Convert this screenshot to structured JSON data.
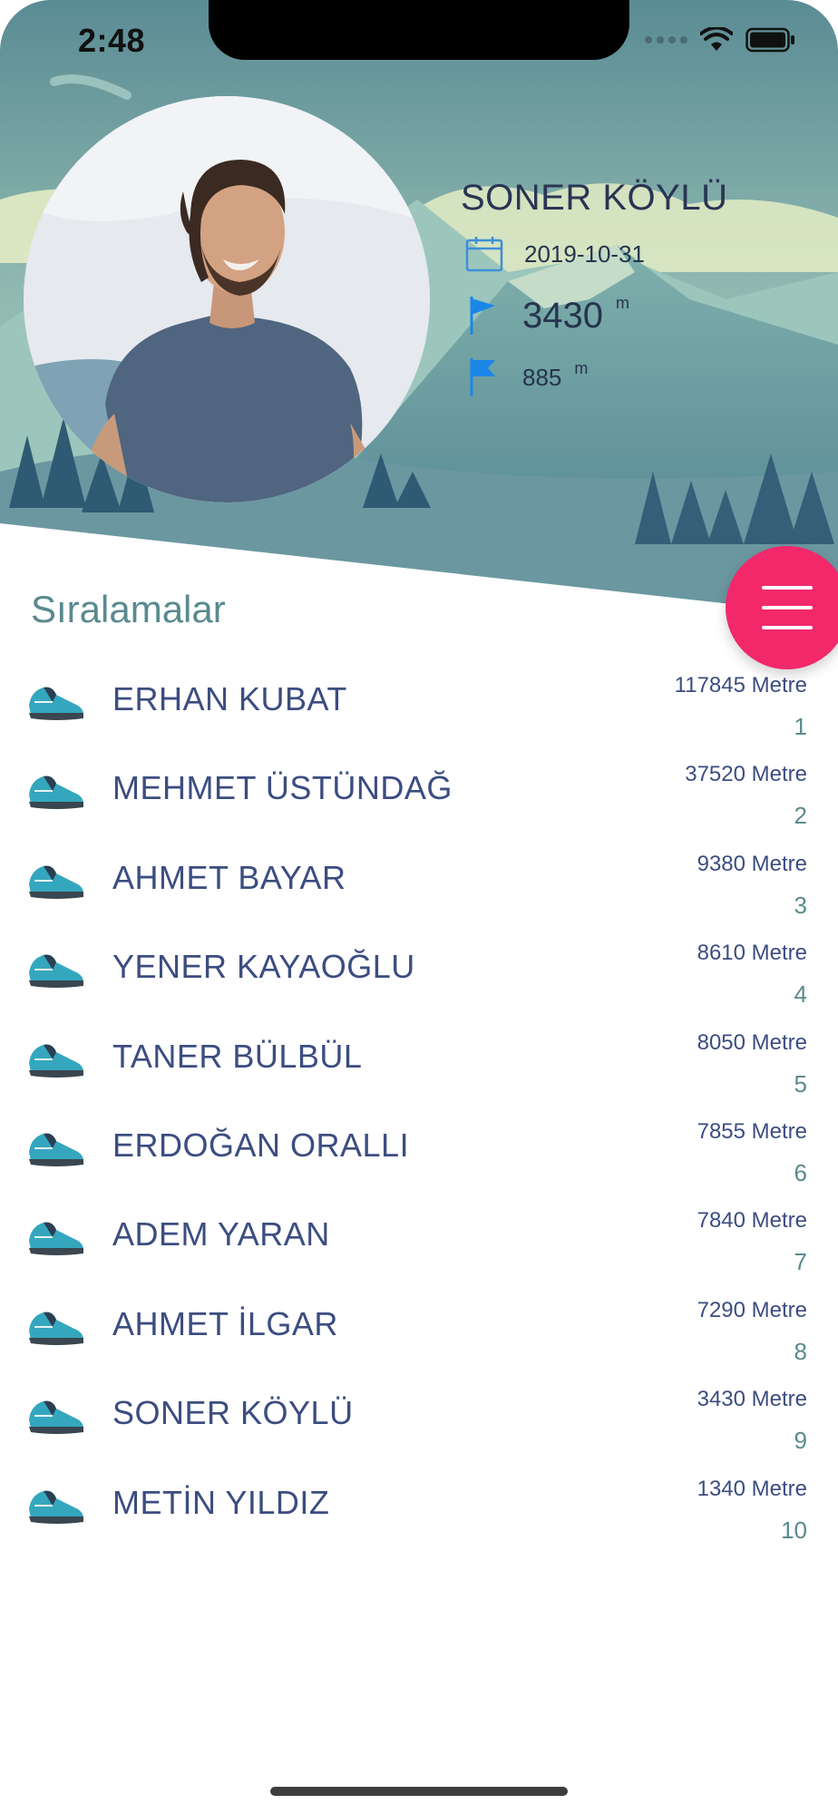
{
  "status_bar": {
    "time": "2:48"
  },
  "profile": {
    "name": "SONER KÖYLÜ",
    "date": "2019-10-31",
    "distance": "3430",
    "distance_unit": "m",
    "climb": "885",
    "climb_unit": "m"
  },
  "section": {
    "title": "Sıralamalar"
  },
  "ranking": [
    {
      "name": "ERHAN KUBAT",
      "distance": "117845 Metre",
      "position": "1"
    },
    {
      "name": "MEHMET ÜSTÜNDAĞ",
      "distance": "37520 Metre",
      "position": "2"
    },
    {
      "name": "AHMET BAYAR",
      "distance": "9380 Metre",
      "position": "3"
    },
    {
      "name": "YENER KAYAOĞLU",
      "distance": "8610 Metre",
      "position": "4"
    },
    {
      "name": "TANER BÜLBÜL",
      "distance": "8050 Metre",
      "position": "5"
    },
    {
      "name": "ERDOĞAN ORALLI",
      "distance": "7855 Metre",
      "position": "6"
    },
    {
      "name": "ADEM YARAN",
      "distance": "7840 Metre",
      "position": "7"
    },
    {
      "name": "AHMET İLGAR",
      "distance": "7290 Metre",
      "position": "8"
    },
    {
      "name": "SONER KÖYLÜ",
      "distance": "3430 Metre",
      "position": "9"
    },
    {
      "name": "METİN YILDIZ",
      "distance": "1340 Metre",
      "position": "10"
    }
  ],
  "icons": {
    "calendar": "calendar-icon",
    "flag": "flag-icon",
    "climb_flag": "flag-icon",
    "menu": "hamburger-menu-icon",
    "shoe": "sneaker-icon"
  },
  "colors": {
    "fab": "#f2286a",
    "name_text": "#3c4d80",
    "section_title": "#5a8a8e",
    "flag_blue": "#1a86e8"
  }
}
